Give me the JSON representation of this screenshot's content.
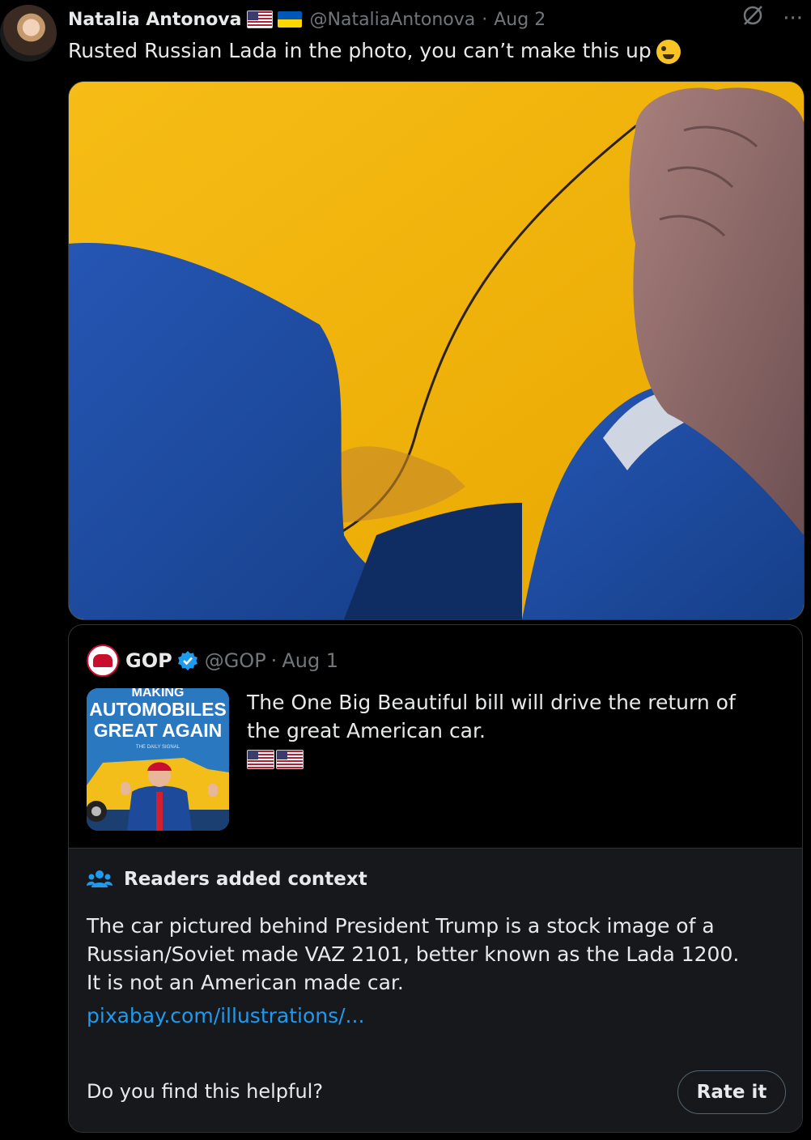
{
  "author": {
    "name": "Natalia Antonova",
    "handle": "@NataliaAntonova",
    "date_sep": "·",
    "date": "Aug 2",
    "flags": [
      "flag-us-icon",
      "flag-ukraine-icon"
    ]
  },
  "tweet": {
    "text": "Rusted Russian Lada in the photo, you can’t make this up",
    "emoji": "zany-face-icon"
  },
  "top_icons": [
    "grok-icon",
    "more-icon"
  ],
  "more_glyph": "···",
  "quoted": {
    "name": "GOP",
    "handle": "@GOP",
    "date_sep": "·",
    "date": "Aug 1",
    "text": "The One Big Beautiful bill will drive the return of the great American car.",
    "thumb_title": [
      "MAKING",
      "AUTOMOBILES",
      "GREAT AGAIN"
    ],
    "thumb_sub": "THE DAILY SIGNAL"
  },
  "community_note": {
    "title": "Readers added context",
    "body": [
      "The car pictured behind President Trump is a stock image of a",
      "Russian/Soviet made VAZ 2101, better known as the Lada 1200.",
      "It is not an American made car."
    ],
    "link": "pixabay.com/illustrations/...",
    "question": "Do you find this helpful?",
    "rate_label": "Rate it"
  },
  "colors": {
    "accent": "#1d9bf0",
    "muted": "#71767b",
    "car_yellow": "#f2b400",
    "suit_blue": "#1c4fa0"
  }
}
